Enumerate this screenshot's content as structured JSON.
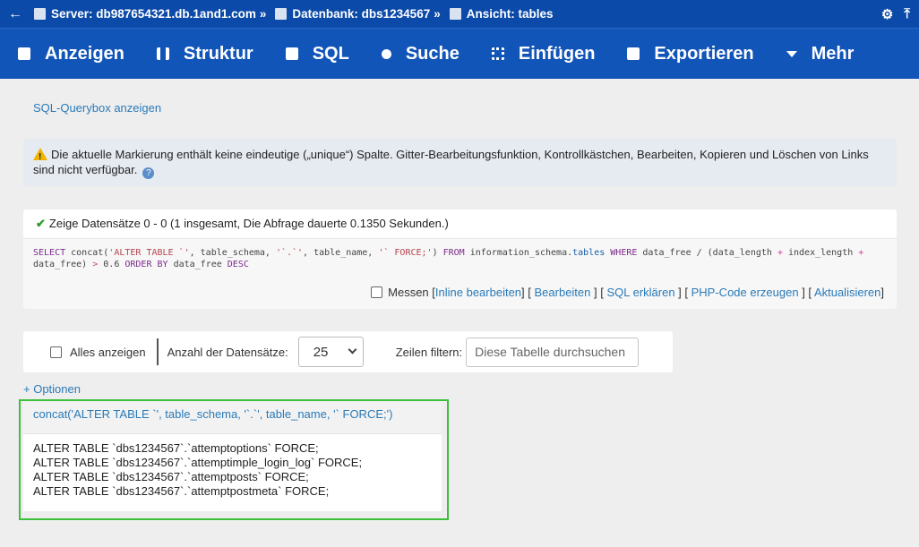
{
  "breadcrumb": {
    "back_icon": "arrow-left-icon",
    "server_label": "Server: db987654321.db.1and1.com",
    "db_label": "Datenbank: dbs1234567",
    "view_label": "Ansicht: tables",
    "separator": "»"
  },
  "tabs": [
    {
      "label": "Anzeigen",
      "icon": "table-icon"
    },
    {
      "label": "Struktur",
      "icon": "structure-icon"
    },
    {
      "label": "SQL",
      "icon": "sql-icon"
    },
    {
      "label": "Suche",
      "icon": "search-icon"
    },
    {
      "label": "Einfügen",
      "icon": "insert-icon"
    },
    {
      "label": "Exportieren",
      "icon": "export-icon"
    },
    {
      "label": "Mehr",
      "icon": "caret-down-icon"
    }
  ],
  "querybox_link": "SQL-Querybox anzeigen",
  "warning": {
    "text": "Die aktuelle Markierung enthält keine eindeutige („unique“) Spalte. Gitter-Bearbeitungsfunktion, Kontrollkästchen, Bearbeiten, Kopieren und Löschen von Links sind nicht verfügbar.",
    "help_symbol": "?"
  },
  "result": {
    "success_text": "Zeige Datensätze 0 - 0 (1 insgesamt, Die Abfrage dauerte 0.1350 Sekunden.)",
    "check_symbol": "✔",
    "actions": {
      "measure": "Messen",
      "inline_edit": "Inline bearbeiten",
      "edit": "Bearbeiten",
      "explain": "SQL erklären",
      "php_code": "PHP-Code erzeugen",
      "refresh": "Aktualisieren"
    }
  },
  "filter": {
    "show_all": "Alles anzeigen",
    "count_label": "Anzahl der Datensätze:",
    "count_value": "25",
    "filter_label": "Zeilen filtern:",
    "search_placeholder": "Diese Tabelle durchsuchen"
  },
  "options_link": "+ Optionen",
  "table": {
    "header": "concat('ALTER TABLE `', table_schema, '`.`', table_name, '` FORCE;')",
    "rows": [
      "ALTER TABLE `dbs1234567`.`attemptoptions` FORCE;",
      "ALTER TABLE `dbs1234567`.`attemptimple_login_log` FORCE;",
      "ALTER TABLE `dbs1234567`.`attemptposts` FORCE;",
      "ALTER TABLE `dbs1234567`.`attemptpostmeta` FORCE;"
    ]
  },
  "colors": {
    "topbar": "#0b4aa8",
    "tabbar": "#1255b8",
    "link": "#2a7ab8",
    "highlight": "#3cc03c"
  }
}
